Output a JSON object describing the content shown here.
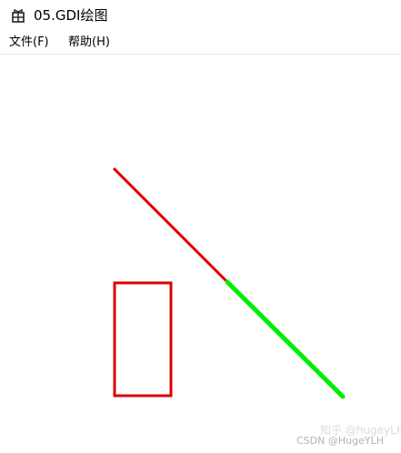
{
  "window": {
    "title": "05.GDI绘图"
  },
  "menu": {
    "file_label": "文件(F)",
    "help_label": "帮助(H)"
  },
  "icons": {
    "app_icon": "app-icon"
  },
  "drawing": {
    "line_color": "#dd0000",
    "green_line_color": "#00ee00",
    "rect_color": "#dd0000"
  },
  "watermark": {
    "line1": "知乎 @hugeyLH",
    "line2": "CSDN @HugeYLH"
  }
}
